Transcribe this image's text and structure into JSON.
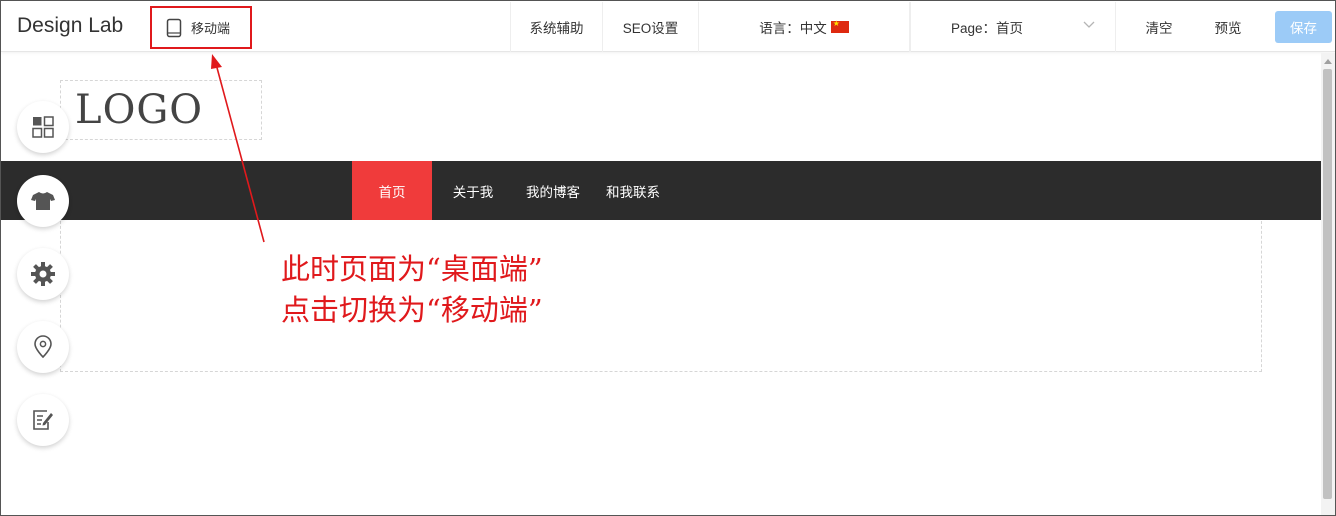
{
  "app": {
    "title": "Design Lab"
  },
  "device_toggle": {
    "label": "移动端",
    "icon": "tablet-icon"
  },
  "toolbar": {
    "system_assist": "系统辅助",
    "seo_settings": "SEO设置",
    "language_label": "语言：中文",
    "language_flag": "china-flag-icon",
    "page_label": "Page：首页",
    "clear": "清空",
    "preview": "预览",
    "save": "保存"
  },
  "canvas": {
    "logo": "LOGO",
    "nav": [
      {
        "label": "首页",
        "active": true
      },
      {
        "label": "关于我",
        "active": false
      },
      {
        "label": "我的博客",
        "active": false
      },
      {
        "label": "和我联系",
        "active": false
      }
    ]
  },
  "sidebar_tools": [
    "widgets-icon",
    "theme-shirt-icon",
    "settings-gear-icon",
    "location-pin-icon",
    "edit-note-icon"
  ],
  "annotation": {
    "line1": "此时页面为“桌面端”",
    "line2": "点击切换为“移动端”"
  },
  "colors": {
    "accent_red": "#e0191c",
    "nav_bg": "#2c2c2c",
    "nav_active": "#f03b3b",
    "save_button": "#9ccbf7"
  }
}
